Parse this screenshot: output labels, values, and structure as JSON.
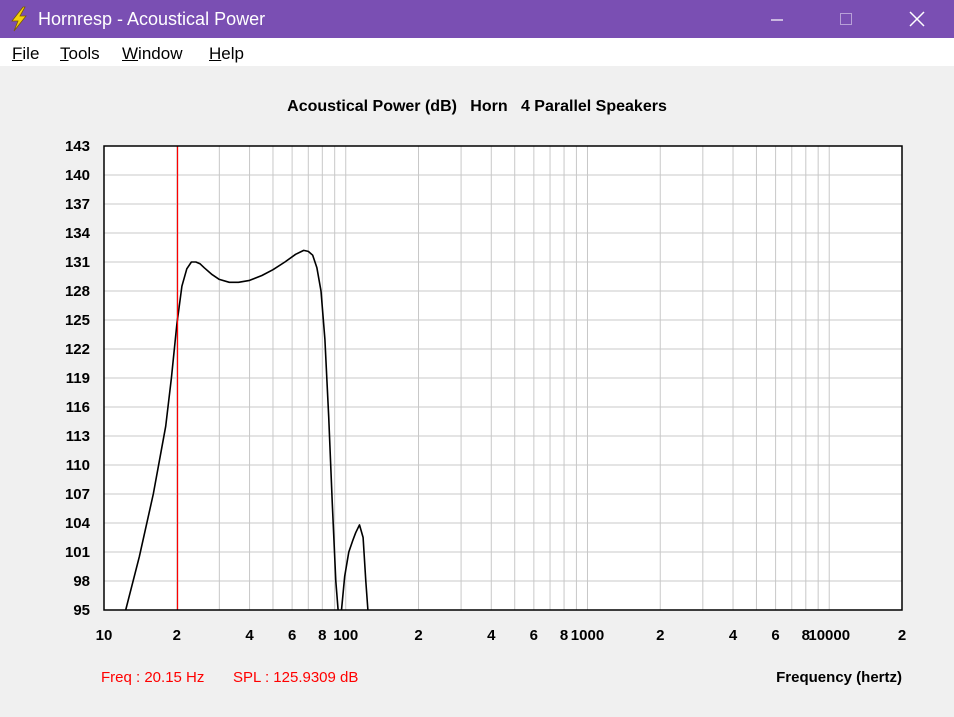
{
  "window": {
    "title": "Hornresp - Acoustical Power",
    "icon": "lightning-bolt-icon"
  },
  "menu": [
    {
      "underline": "F",
      "rest": "ile"
    },
    {
      "underline": "T",
      "rest": "ools"
    },
    {
      "underline": "W",
      "rest": "indow"
    },
    {
      "underline": "H",
      "rest": "elp"
    }
  ],
  "status": {
    "freq": "Freq : 20.15 Hz",
    "spl": "SPL : 125.9309 dB"
  },
  "chart_data": {
    "type": "line",
    "title": "Acoustical Power (dB)   Horn   4 Parallel Speakers",
    "xlabel": "Frequency (hertz)",
    "ylabel": "",
    "x_scale": "log",
    "xlim": [
      10,
      20000
    ],
    "ylim": [
      95,
      143
    ],
    "y_ticks": [
      "143",
      "140",
      "137",
      "134",
      "131",
      "128",
      "125",
      "122",
      "119",
      "116",
      "113",
      "110",
      "107",
      "104",
      "101",
      "98",
      "95"
    ],
    "x_ticks": [
      {
        "value": 10,
        "label": "10"
      },
      {
        "value": 20,
        "label": "2"
      },
      {
        "value": 40,
        "label": "4"
      },
      {
        "value": 60,
        "label": "6"
      },
      {
        "value": 80,
        "label": "8"
      },
      {
        "value": 100,
        "label": "100"
      },
      {
        "value": 200,
        "label": "2"
      },
      {
        "value": 400,
        "label": "4"
      },
      {
        "value": 600,
        "label": "6"
      },
      {
        "value": 800,
        "label": "8"
      },
      {
        "value": 1000,
        "label": "1000"
      },
      {
        "value": 2000,
        "label": "2"
      },
      {
        "value": 4000,
        "label": "4"
      },
      {
        "value": 6000,
        "label": "6"
      },
      {
        "value": 8000,
        "label": "8"
      },
      {
        "value": 10000,
        "label": "10000"
      },
      {
        "value": 20000,
        "label": "2"
      }
    ],
    "grid": true,
    "marker": {
      "x": 20.15,
      "y": 125.9309,
      "color": "#ff0000"
    },
    "series": [
      {
        "color": "#000000",
        "segments": [
          [
            [
              12.3,
              95
            ],
            [
              14,
              100.5
            ],
            [
              16,
              107
            ],
            [
              18,
              114
            ],
            [
              19,
              119
            ],
            [
              20,
              124.5
            ],
            [
              21,
              128.5
            ],
            [
              22,
              130.3
            ],
            [
              23,
              131
            ],
            [
              24,
              131
            ],
            [
              25,
              130.8
            ],
            [
              26,
              130.4
            ],
            [
              28,
              129.7
            ],
            [
              30,
              129.2
            ],
            [
              33,
              128.9
            ],
            [
              36,
              128.9
            ],
            [
              40,
              129.1
            ],
            [
              45,
              129.6
            ],
            [
              50,
              130.2
            ],
            [
              56,
              131
            ],
            [
              62,
              131.8
            ],
            [
              67,
              132.2
            ],
            [
              70,
              132.1
            ],
            [
              73,
              131.7
            ],
            [
              76,
              130.4
            ],
            [
              79,
              128
            ],
            [
              82,
              123
            ],
            [
              85,
              115
            ],
            [
              88,
              106
            ],
            [
              91,
              98
            ],
            [
              93,
              95
            ]
          ],
          [
            [
              96,
              95
            ],
            [
              99,
              98.5
            ],
            [
              103,
              101
            ],
            [
              107,
              102.2
            ],
            [
              110,
              103
            ],
            [
              114,
              103.8
            ],
            [
              118,
              102.5
            ],
            [
              121,
              98
            ],
            [
              123.5,
              95
            ]
          ]
        ]
      }
    ]
  }
}
